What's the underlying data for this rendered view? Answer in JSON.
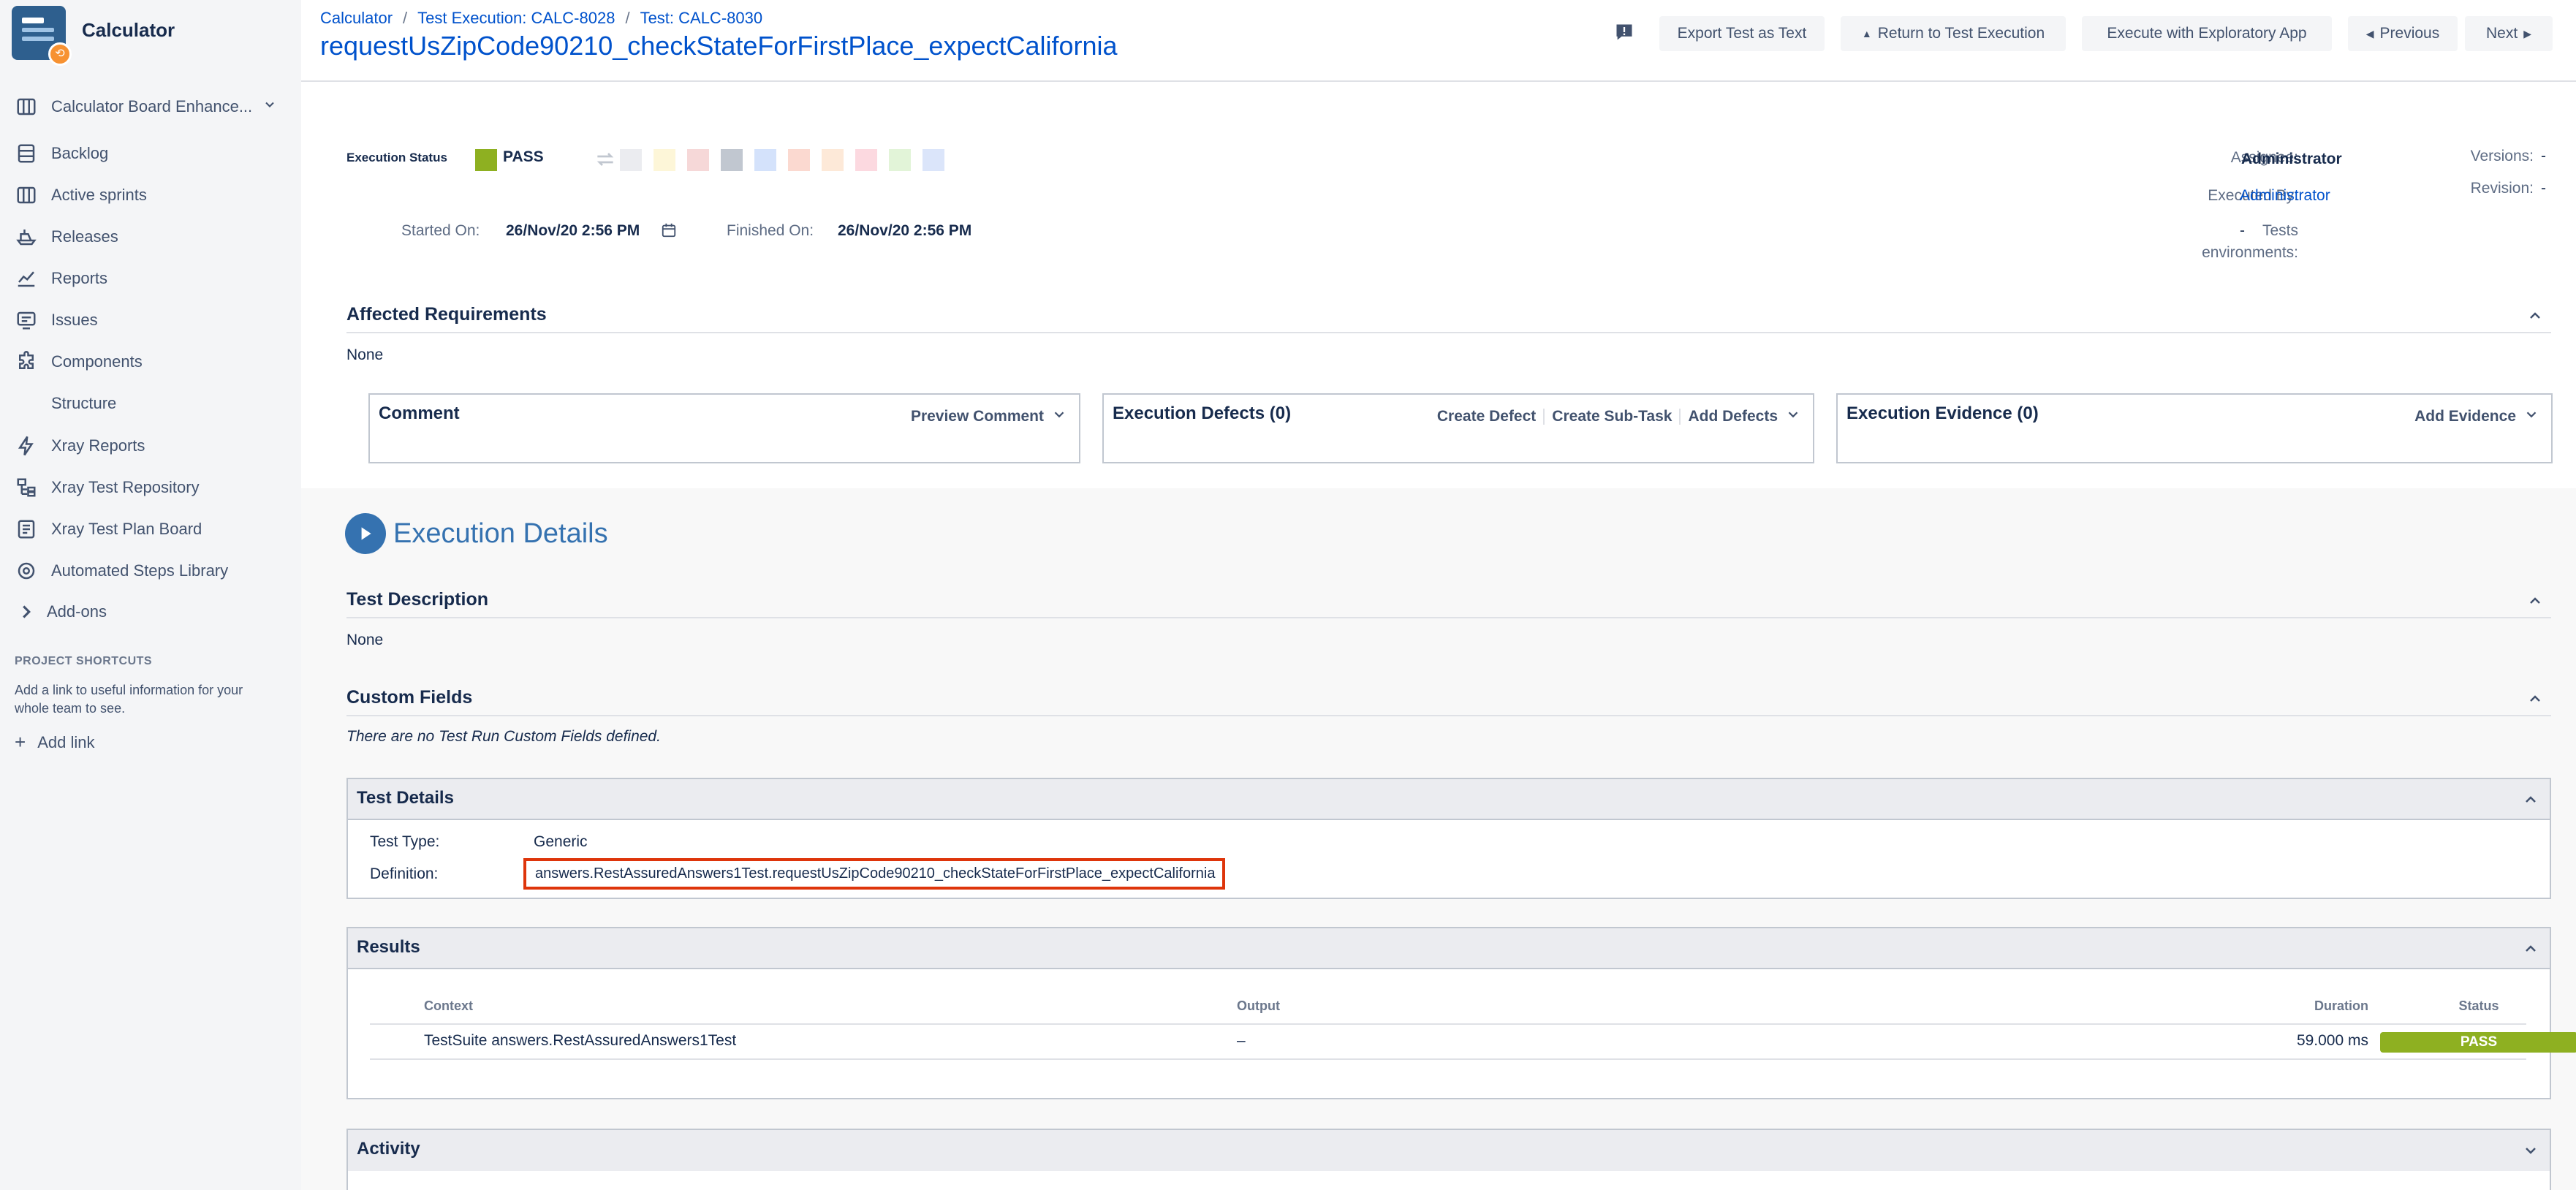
{
  "sidebar": {
    "project_name": "Calculator",
    "board_name": "Calculator Board Enhance...",
    "items": [
      {
        "label": "Backlog",
        "icon": "backlog-icon"
      },
      {
        "label": "Active sprints",
        "icon": "board-icon"
      },
      {
        "label": "Releases",
        "icon": "ship-icon"
      },
      {
        "label": "Reports",
        "icon": "chart-icon"
      },
      {
        "label": "Issues",
        "icon": "issues-icon"
      },
      {
        "label": "Components",
        "icon": "puzzle-icon"
      },
      {
        "label": "Structure",
        "icon": ""
      },
      {
        "label": "Xray Reports",
        "icon": "bolt-icon"
      },
      {
        "label": "Xray Test Repository",
        "icon": "repository-icon"
      },
      {
        "label": "Xray Test Plan Board",
        "icon": "plan-board-icon"
      },
      {
        "label": "Automated Steps Library",
        "icon": "library-icon"
      },
      {
        "label": "Add-ons",
        "icon": "chevron-right-icon"
      }
    ],
    "shortcuts_title": "PROJECT SHORTCUTS",
    "shortcuts_desc": "Add a link to useful information for your whole team to see.",
    "add_link": "Add link"
  },
  "header": {
    "breadcrumb": [
      "Calculator",
      "Test Execution: CALC-8028",
      "Test: CALC-8030"
    ],
    "title": "requestUsZipCode90210_checkStateForFirstPlace_expectCalifornia",
    "buttons": {
      "export": "Export Test as Text",
      "return": "Return to Test Execution",
      "exploratory": "Execute with Exploratory App",
      "previous": "Previous",
      "next": "Next"
    }
  },
  "execution": {
    "status_label": "Execution Status",
    "status_value": "PASS",
    "status_color": "#8eb021",
    "started_label": "Started On:",
    "started_value": "26/Nov/20 2:56 PM",
    "finished_label": "Finished On:",
    "finished_value": "26/Nov/20 2:56 PM",
    "assignee_label": "Assignee:",
    "assignee_value": "Administrator",
    "executed_by_label": "Executed By:",
    "executed_by_value": "Administrator",
    "tests_env_label_1": "Tests",
    "tests_env_label_2": "environments:",
    "tests_env_value": "-",
    "versions_label": "Versions:",
    "versions_value": "-",
    "revision_label": "Revision:",
    "revision_value": "-"
  },
  "affected": {
    "title": "Affected Requirements",
    "value": "None"
  },
  "panels": {
    "comment_title": "Comment",
    "comment_action": "Preview Comment",
    "defects_title": "Execution Defects (0)",
    "defects_actions": [
      "Create Defect",
      "Create Sub-Task",
      "Add Defects"
    ],
    "evidence_title": "Execution Evidence (0)",
    "evidence_action": "Add Evidence"
  },
  "details": {
    "title": "Execution Details",
    "test_desc_title": "Test Description",
    "test_desc_value": "None",
    "custom_fields_title": "Custom Fields",
    "custom_fields_value": "There are no Test Run Custom Fields defined.",
    "test_details_title": "Test Details",
    "test_type_label": "Test Type:",
    "test_type_value": "Generic",
    "definition_label": "Definition:",
    "definition_value": "answers.RestAssuredAnswers1Test.requestUsZipCode90210_checkStateForFirstPlace_expectCalifornia",
    "results_title": "Results",
    "results_headers": [
      "Context",
      "Output",
      "Duration",
      "Status"
    ],
    "results_row": {
      "context": "TestSuite answers.RestAssuredAnswers1Test",
      "output": "–",
      "duration": "59.000 ms",
      "status": "PASS"
    },
    "activity_title": "Activity"
  }
}
